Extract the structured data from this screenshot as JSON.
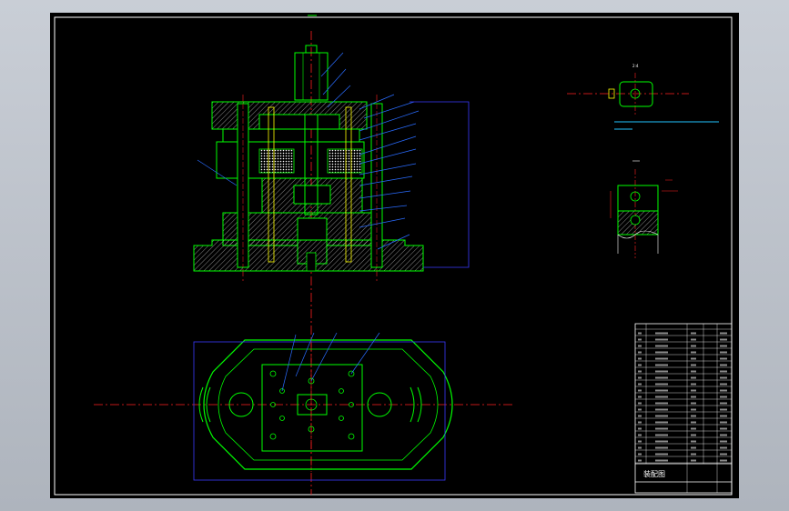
{
  "colors": {
    "background": "#000000",
    "frame": "#ffffff",
    "outline": "#00ff00",
    "center_line": "#ff2020",
    "leader": "#2a6cff",
    "hatch": "#e6e6e6",
    "dimension_box": "#3a3aff",
    "note": "#22c4ff",
    "accent_yellow": "#ffff00"
  },
  "detail_views": {
    "top_label": "2:4",
    "bottom_label": "",
    "note_text_line1": "",
    "note_text_line2": ""
  },
  "title_block": {
    "drawing_name": "装配图",
    "rows": [
      {
        "no": "",
        "name": "",
        "qty": "",
        "material": ""
      },
      {
        "no": "",
        "name": "",
        "qty": "",
        "material": ""
      }
    ]
  }
}
